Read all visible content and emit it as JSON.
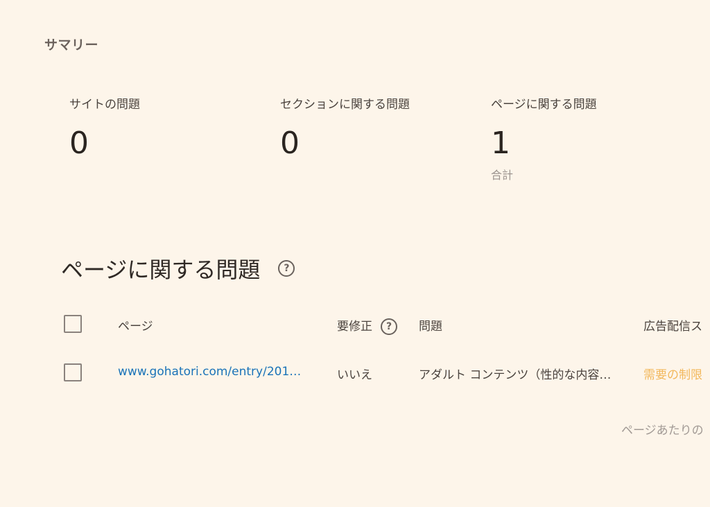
{
  "summary": {
    "title": "サマリー",
    "stats": [
      {
        "label": "サイトの問題",
        "value": "0"
      },
      {
        "label": "セクションに関する問題",
        "value": "0"
      },
      {
        "label": "ページに関する問題",
        "value": "1",
        "sub": "合計"
      }
    ]
  },
  "page_issues": {
    "title": "ページに関する問題",
    "help_icon": "help-circle-icon",
    "columns": {
      "page": "ページ",
      "needs_fix": "要修正",
      "issue": "問題",
      "ad_status": "広告配信ス"
    },
    "rows": [
      {
        "page": "www.gohatori.com/entry/201…",
        "needs_fix": "いいえ",
        "issue": "アダルト コンテンツ（性的な内容…",
        "ad_status": "需要の制限"
      }
    ],
    "footer": "ページあたりの"
  },
  "colors": {
    "background": "#fdf5ea",
    "link": "#1a73b8",
    "warning": "#f2b85c"
  }
}
